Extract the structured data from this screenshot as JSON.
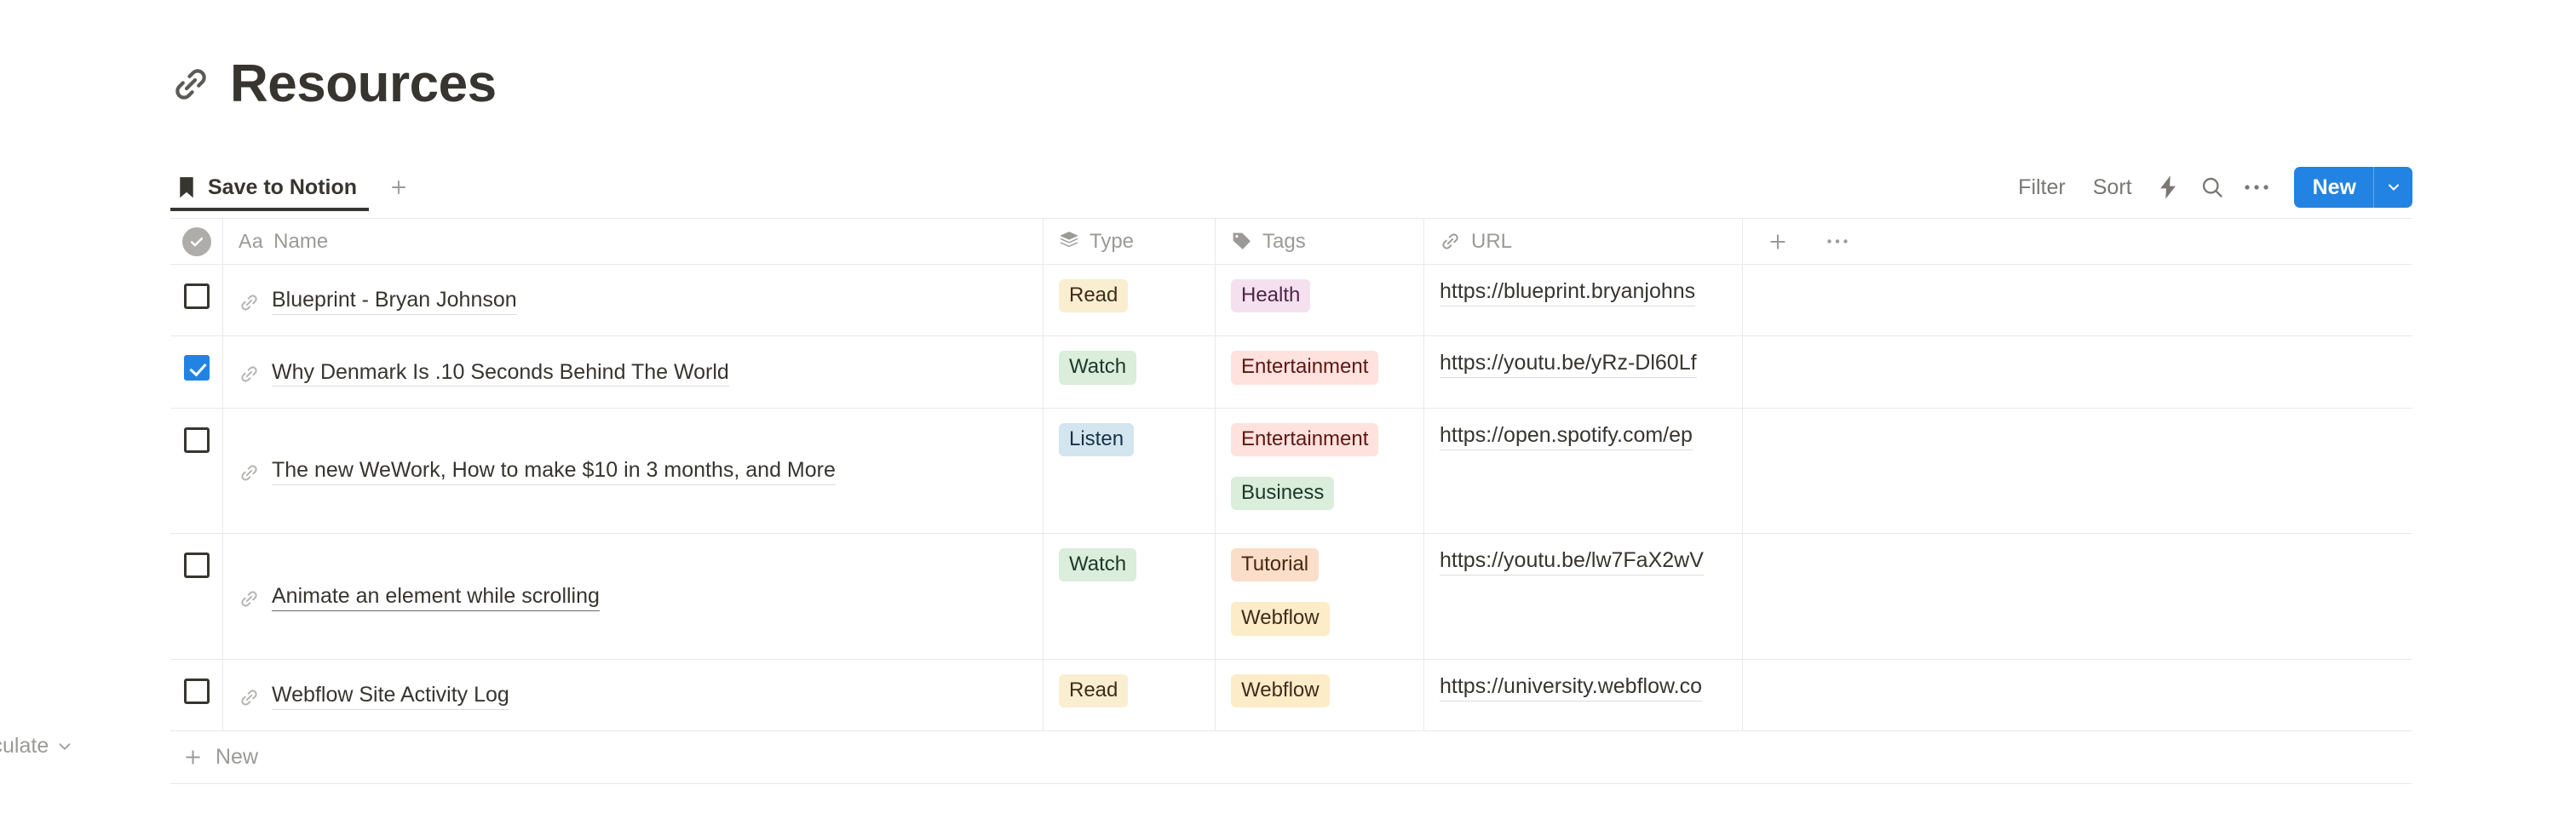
{
  "page": {
    "title": "Resources",
    "title_icon": "link-icon"
  },
  "tabs": [
    {
      "label": "Save to Notion",
      "icon": "bookmark-icon",
      "active": true
    }
  ],
  "tab_add": {
    "icon": "plus-icon",
    "label": "+"
  },
  "toolbar": {
    "filter_label": "Filter",
    "sort_label": "Sort",
    "automation_icon": "lightning-bolt-icon",
    "search_icon": "search-icon",
    "more_icon": "ellipsis-icon",
    "new_label": "New",
    "new_caret_icon": "chevron-down-icon",
    "accent_color": "#2383e2"
  },
  "table": {
    "select_all_icon": "check-circle-icon",
    "columns": [
      {
        "key": "name",
        "label": "Name",
        "icon": "aa-text-icon"
      },
      {
        "key": "type",
        "label": "Type",
        "icon": "select-layers-icon"
      },
      {
        "key": "tags",
        "label": "Tags",
        "icon": "tag-icon"
      },
      {
        "key": "url",
        "label": "URL",
        "icon": "link-icon"
      }
    ],
    "add_column_icon": "plus-icon",
    "column_options_icon": "ellipsis-icon",
    "rows": [
      {
        "checked": false,
        "name": "Blueprint - Bryan Johnson",
        "name_icon": "link-icon",
        "type": {
          "label": "Read",
          "bg": "#faeed1",
          "fg": "#402c1b"
        },
        "tags": [
          {
            "label": "Health",
            "bg": "#f5e0f0",
            "fg": "#4d2645"
          }
        ],
        "url": "https://blueprint.bryanjohns"
      },
      {
        "checked": true,
        "name": "Why Denmark Is .10 Seconds Behind The World",
        "name_icon": "link-icon",
        "type": {
          "label": "Watch",
          "bg": "#dbeddb",
          "fg": "#1c3829"
        },
        "tags": [
          {
            "label": "Entertainment",
            "bg": "#ffe2dd",
            "fg": "#5d1715"
          }
        ],
        "url": "https://youtu.be/yRz-Dl60Lf"
      },
      {
        "checked": false,
        "name": "The new WeWork, How to make $10 in 3 months, and More",
        "name_icon": "link-icon",
        "type": {
          "label": "Listen",
          "bg": "#d3e5ef",
          "fg": "#183347"
        },
        "tags": [
          {
            "label": "Entertainment",
            "bg": "#ffe2dd",
            "fg": "#5d1715"
          },
          {
            "label": "Business",
            "bg": "#dbeddb",
            "fg": "#1c3829"
          }
        ],
        "url": "https://open.spotify.com/ep"
      },
      {
        "checked": false,
        "name": "Animate an element while scrolling",
        "name_icon": "link-icon",
        "strong_underline": true,
        "type": {
          "label": "Watch",
          "bg": "#dbeddb",
          "fg": "#1c3829"
        },
        "tags": [
          {
            "label": "Tutorial",
            "bg": "#fadec9",
            "fg": "#49290e"
          },
          {
            "label": "Webflow",
            "bg": "#fdecc8",
            "fg": "#402c1b"
          }
        ],
        "url": "https://youtu.be/lw7FaX2wV"
      },
      {
        "checked": false,
        "name": "Webflow Site Activity Log",
        "name_icon": "link-icon",
        "type": {
          "label": "Read",
          "bg": "#faeed1",
          "fg": "#402c1b"
        },
        "tags": [
          {
            "label": "Webflow",
            "bg": "#fdecc8",
            "fg": "#402c1b"
          }
        ],
        "url": "https://university.webflow.co"
      }
    ],
    "new_row_label": "New",
    "new_row_icon": "plus-icon"
  },
  "footer": {
    "calculate_label": "Calculate",
    "calculate_caret_icon": "chevron-down-icon"
  }
}
